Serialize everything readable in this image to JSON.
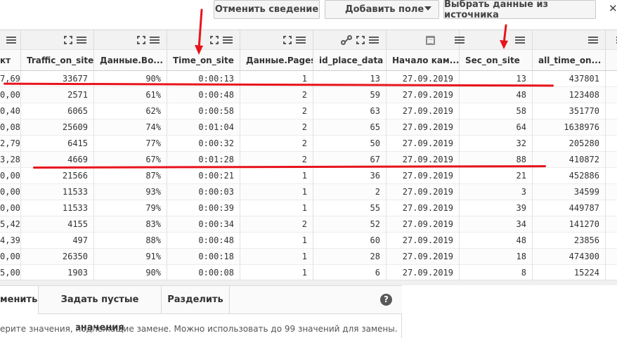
{
  "toolbar": {
    "unpivot_label": "Отменить сведение",
    "add_field_label": "Добавить поле",
    "select_source_label": "Выбрать данные из источника",
    "close_glyph": "✕"
  },
  "columns": [
    {
      "key": "c0",
      "label": "кт",
      "icons": [
        "menu-icon"
      ]
    },
    {
      "key": "c1",
      "label": "Traffic_on_site",
      "icons": [
        "expand-icon",
        "menu-icon"
      ]
    },
    {
      "key": "c2",
      "label": "Данные.Во...",
      "icons": [
        "expand-icon",
        "menu-icon"
      ]
    },
    {
      "key": "c3",
      "label": "Time_on_site",
      "icons": [
        "expand-icon",
        "menu-icon"
      ]
    },
    {
      "key": "c4",
      "label": "Данные.Pages",
      "icons": [
        "expand-icon",
        "menu-icon"
      ]
    },
    {
      "key": "c5",
      "label": "id_place_data",
      "icons": [
        "link-icon",
        "expand-icon",
        "menu-icon"
      ]
    },
    {
      "key": "c6",
      "label": "Начало кам...",
      "icons": [
        "calendar-icon",
        "menu-icon"
      ]
    },
    {
      "key": "c7",
      "label": "Sec_on_site",
      "icons": [
        "menu-icon"
      ]
    },
    {
      "key": "c8",
      "label": "all_time_on...",
      "icons": [
        "menu-icon"
      ]
    },
    {
      "key": "c9",
      "label": "",
      "icons": [
        "menu-icon"
      ]
    }
  ],
  "rows": [
    [
      "7,69",
      "33677",
      "90%",
      "0:00:13",
      "1",
      "13",
      "27.09.2019",
      "13",
      "437801"
    ],
    [
      "0,00",
      "2571",
      "61%",
      "0:00:48",
      "2",
      "59",
      "27.09.2019",
      "48",
      "123408"
    ],
    [
      "0,40",
      "6065",
      "62%",
      "0:00:58",
      "2",
      "63",
      "27.09.2019",
      "58",
      "351770"
    ],
    [
      "0,08",
      "25609",
      "74%",
      "0:01:04",
      "2",
      "65",
      "27.09.2019",
      "64",
      "1638976"
    ],
    [
      "2,79",
      "6415",
      "77%",
      "0:00:32",
      "2",
      "50",
      "27.09.2019",
      "32",
      "205280"
    ],
    [
      "3,28",
      "4669",
      "67%",
      "0:01:28",
      "2",
      "67",
      "27.09.2019",
      "88",
      "410872"
    ],
    [
      "0,00",
      "21566",
      "87%",
      "0:00:21",
      "1",
      "36",
      "27.09.2019",
      "21",
      "452886"
    ],
    [
      "0,00",
      "11533",
      "93%",
      "0:00:03",
      "1",
      "2",
      "27.09.2019",
      "3",
      "34599"
    ],
    [
      "0,00",
      "11533",
      "79%",
      "0:00:39",
      "1",
      "55",
      "27.09.2019",
      "39",
      "449787"
    ],
    [
      "5,42",
      "4155",
      "83%",
      "0:00:34",
      "2",
      "52",
      "27.09.2019",
      "34",
      "141270"
    ],
    [
      "4,39",
      "497",
      "88%",
      "0:00:48",
      "1",
      "60",
      "27.09.2019",
      "48",
      "23856"
    ],
    [
      "0,00",
      "26350",
      "91%",
      "0:00:18",
      "1",
      "28",
      "27.09.2019",
      "18",
      "474300"
    ],
    [
      "5,00",
      "1903",
      "90%",
      "0:00:08",
      "1",
      "6",
      "27.09.2019",
      "8",
      "15224"
    ]
  ],
  "panel": {
    "tabs": [
      "менить",
      "Задать пустые значения",
      "Разделить"
    ],
    "help_glyph": "?",
    "hint": "ерите значения, подлежащие замене. Можно использовать до 99 значений для замены."
  },
  "colors": {
    "annotation_red": "#e8141c"
  }
}
